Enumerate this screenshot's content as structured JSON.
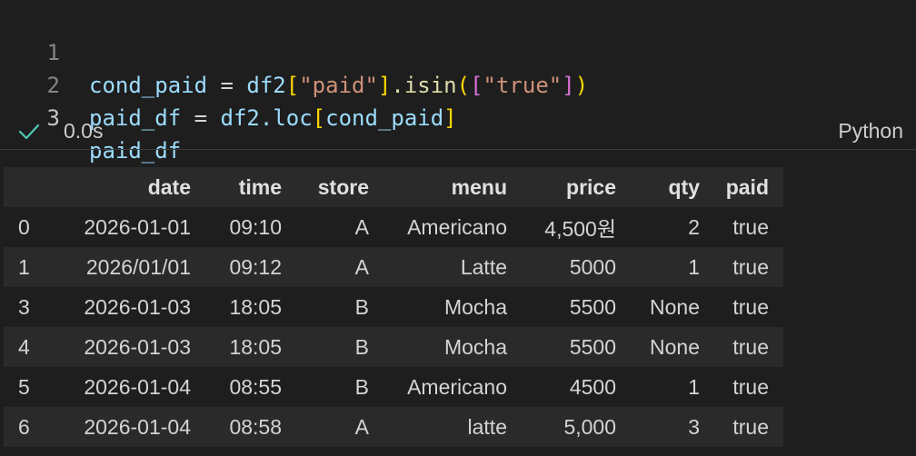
{
  "code": {
    "lines": [
      {
        "number": "1"
      },
      {
        "number": "2"
      },
      {
        "number": "3"
      }
    ],
    "line1": {
      "var": "cond_paid",
      "eq": " = ",
      "obj": "df2",
      "br_open": "[",
      "key": "\"paid\"",
      "br_close": "]",
      "method": ".isin",
      "paren_open": "(",
      "list_open": "[",
      "value": "\"true\"",
      "list_close": "]",
      "paren_close": ")"
    },
    "line2": {
      "var": "paid_df",
      "eq": " = ",
      "obj": "df2",
      "dot_loc": ".loc",
      "br_open": "[",
      "arg": "cond_paid",
      "br_close": "]"
    },
    "line3": {
      "var": "paid_df"
    }
  },
  "status": {
    "icon": "check-icon",
    "exec_time": "0.0s",
    "kernel": "Python"
  },
  "table": {
    "columns": [
      "",
      "date",
      "time",
      "store",
      "menu",
      "price",
      "qty",
      "paid"
    ],
    "rows": [
      [
        "0",
        "2026-01-01",
        "09:10",
        "A",
        "Americano",
        "4,500원",
        "2",
        "true"
      ],
      [
        "1",
        "2026/01/01",
        "09:12",
        "A",
        "Latte",
        "5000",
        "1",
        "true"
      ],
      [
        "3",
        "2026-01-03",
        "18:05",
        "B",
        "Mocha",
        "5500",
        "None",
        "true"
      ],
      [
        "4",
        "2026-01-03",
        "18:05",
        "B",
        "Mocha",
        "5500",
        "None",
        "true"
      ],
      [
        "5",
        "2026-01-04",
        "08:55",
        "B",
        "Americano",
        "4500",
        "1",
        "true"
      ],
      [
        "6",
        "2026-01-04",
        "08:58",
        "A",
        "latte",
        "5,000",
        "3",
        "true"
      ]
    ]
  },
  "colors": {
    "background": "#1e1e1e",
    "stripe": "#2a2a2a",
    "check": "#4ec9b0"
  }
}
